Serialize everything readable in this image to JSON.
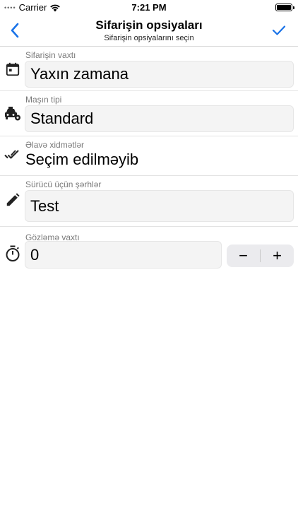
{
  "status_bar": {
    "signal": "••••",
    "carrier": "Carrier",
    "time": "7:21 PM"
  },
  "nav": {
    "title": "Sifarişin opsiyaları",
    "subtitle": "Sifarişin opsiyalarını seçin",
    "back_icon": "chevron-left-icon",
    "done_icon": "checkmark-icon",
    "accent_color": "#1a73e8"
  },
  "options": {
    "order_time": {
      "label": "Sifarişin vaxtı",
      "value": "Yaxın zamana",
      "icon": "calendar-icon"
    },
    "car_type": {
      "label": "Maşın tipi",
      "value": "Standard",
      "icon": "taxi-icon"
    },
    "extra_services": {
      "label": "Əlavə xidmətlər",
      "value": "Seçim edilməyib",
      "icon": "double-check-icon"
    },
    "driver_notes": {
      "label": "Sürücü üçün şərhlər",
      "value": "Test",
      "icon": "pencil-icon"
    },
    "wait_time": {
      "label": "Gözləmə vaxtı",
      "value": "0",
      "icon": "stopwatch-icon",
      "decrement": "−",
      "increment": "+"
    }
  }
}
